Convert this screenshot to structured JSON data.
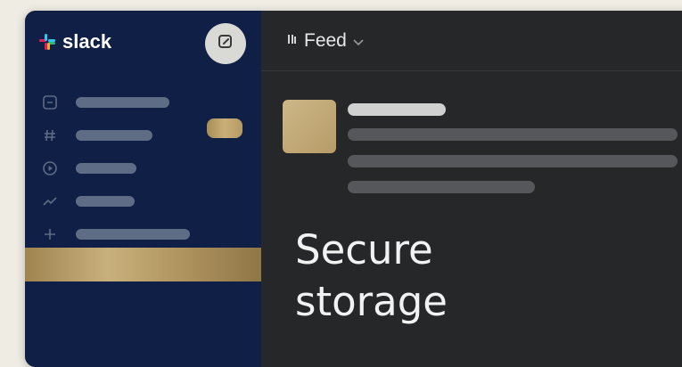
{
  "app": {
    "brand_name": "slack",
    "colors": {
      "sidebar": "#0f1f45",
      "main": "#262729",
      "gold": "#c8b07c",
      "skeleton": "#5f6c86"
    }
  },
  "sidebar": {
    "compose_icon": "compose-icon",
    "items": [
      {
        "icon": "home-icon"
      },
      {
        "icon": "hash-icon"
      },
      {
        "icon": "play-icon"
      },
      {
        "icon": "activity-icon"
      },
      {
        "icon": "more-icon"
      }
    ]
  },
  "header": {
    "channel_label": "Feed",
    "channel_icon": "feed-icon",
    "dropdown_icon": "chevron-down-icon",
    "info_icon": "info-icon"
  },
  "hero": {
    "line1": "Secure",
    "line2": "storage"
  }
}
